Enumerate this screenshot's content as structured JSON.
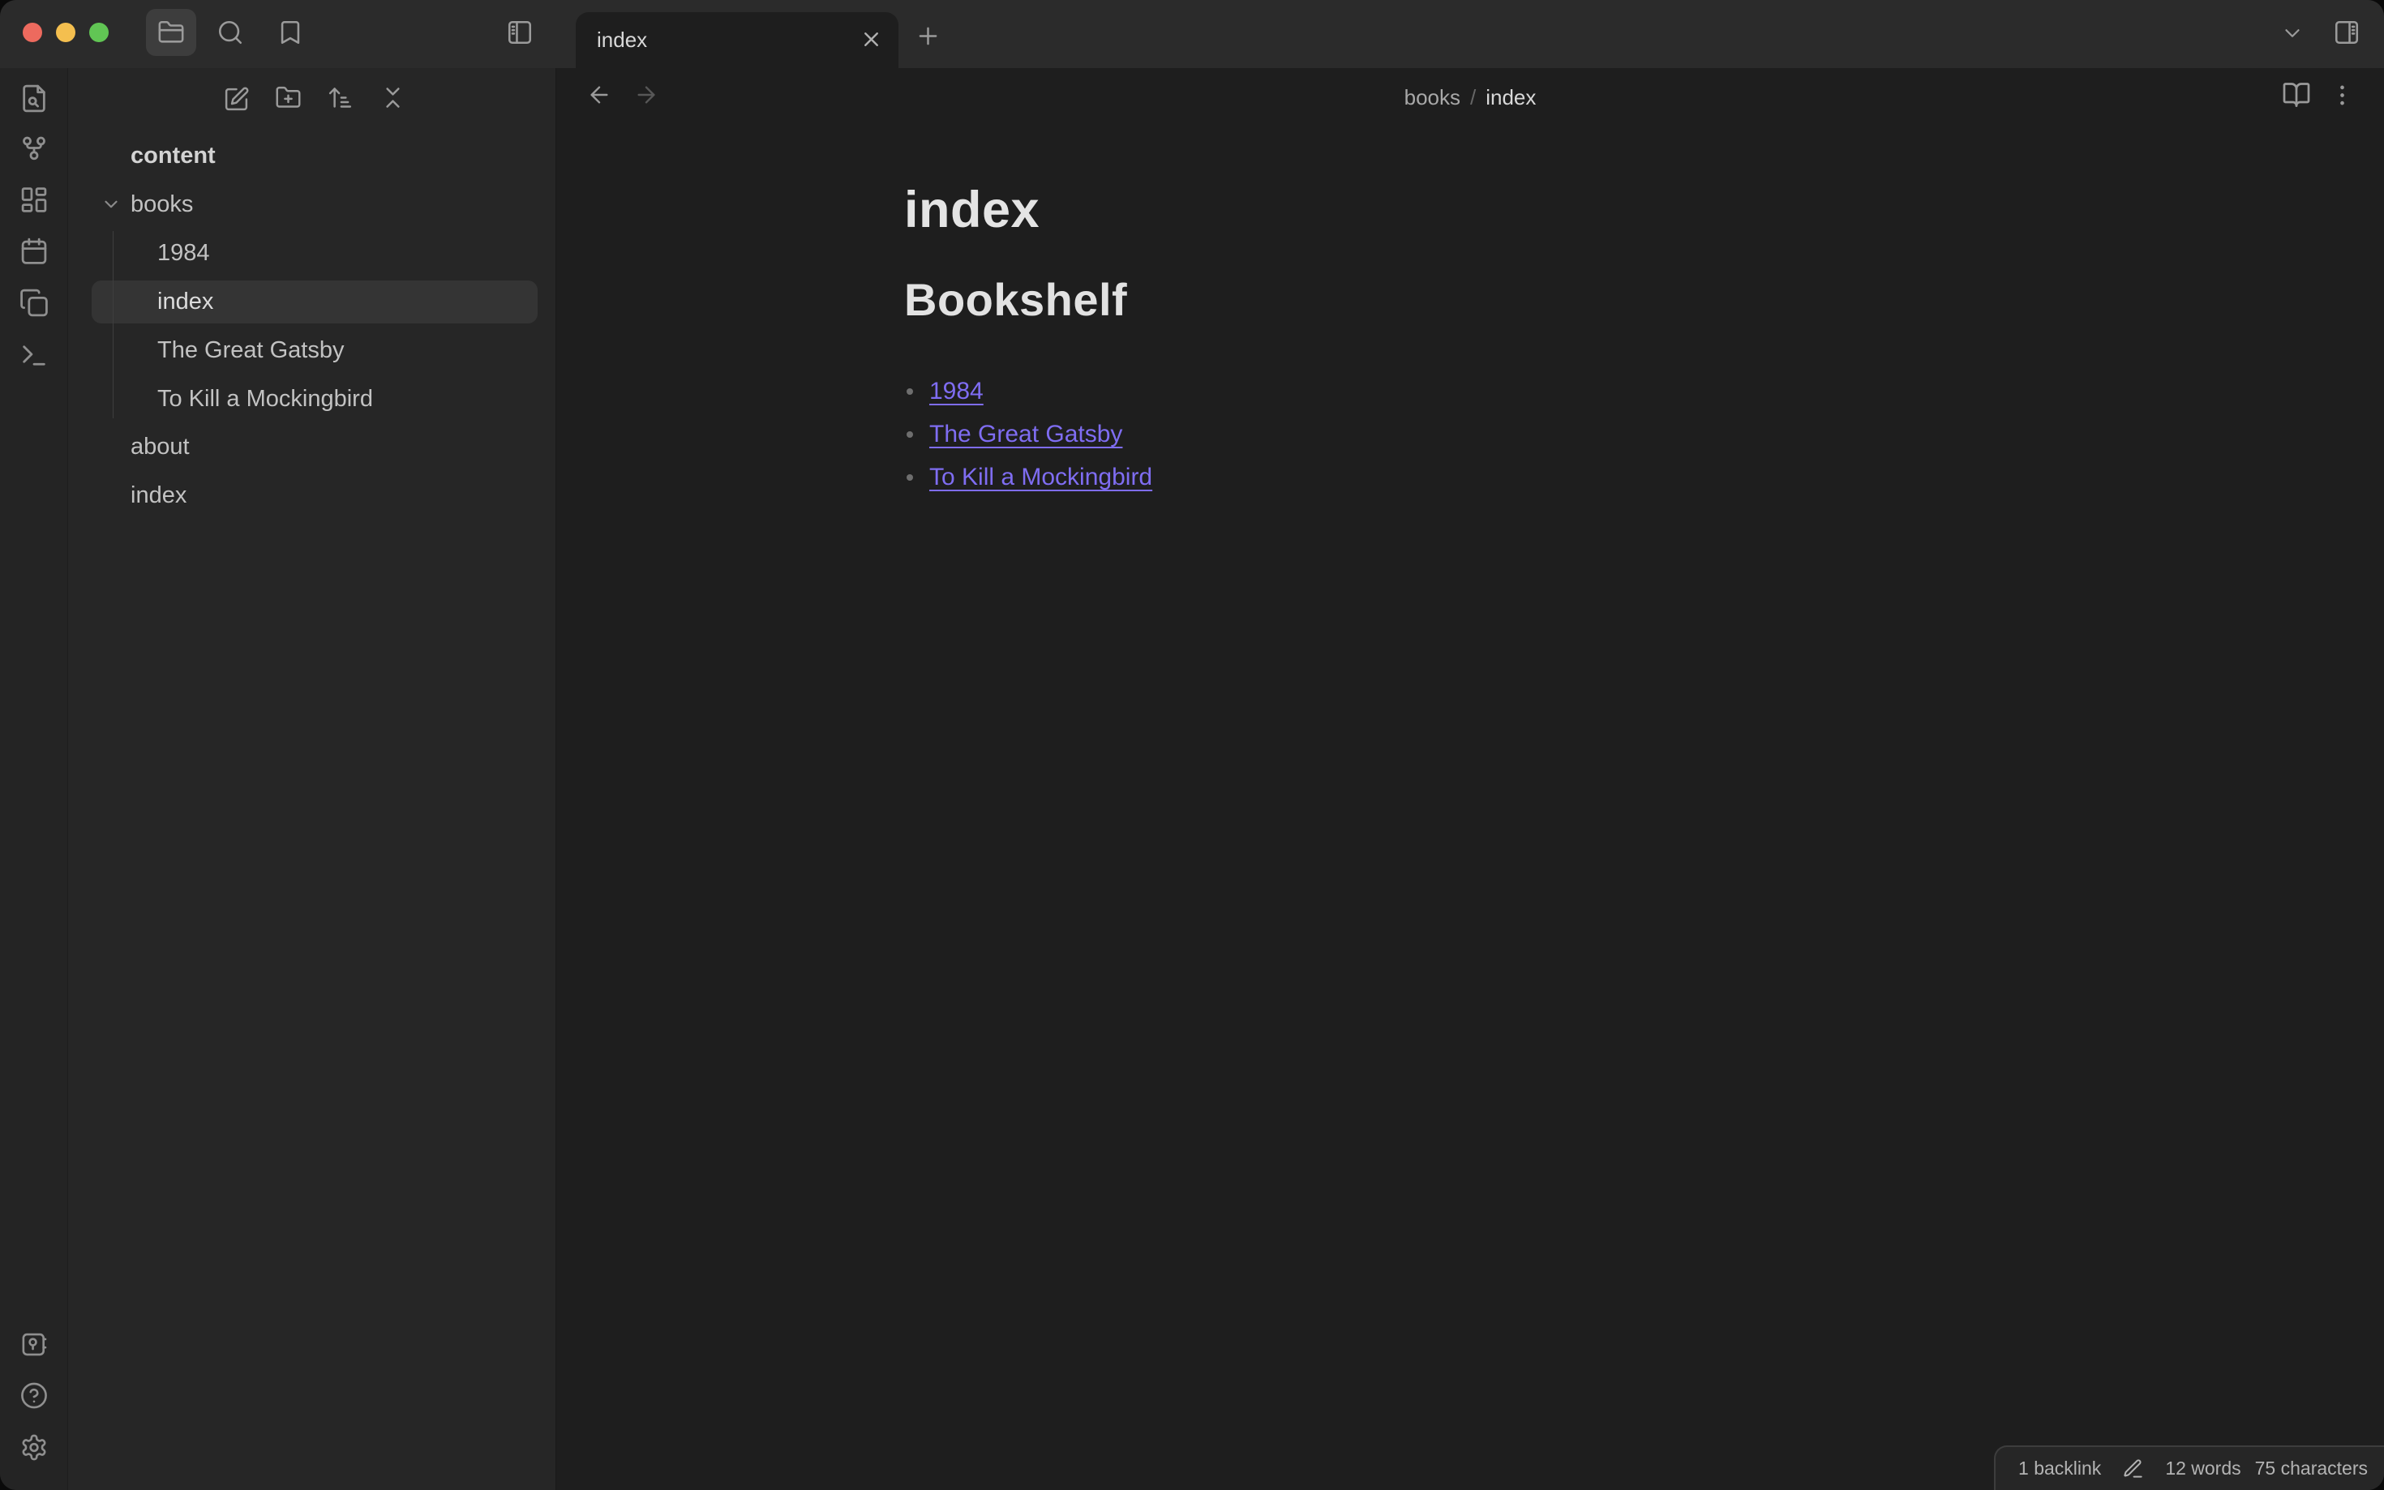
{
  "colors": {
    "accent": "#7f6df2",
    "editor_bg": "#1e1e1e",
    "sidebar_bg": "#262626",
    "titlebar_bg": "#2b2b2b",
    "ribbon_bg": "#242424"
  },
  "titlebar": {
    "tab": {
      "title": "index"
    }
  },
  "sidebar": {
    "vault_name": "content",
    "items": [
      {
        "label": "books",
        "type": "folder",
        "expanded": true
      },
      {
        "label": "1984",
        "type": "file"
      },
      {
        "label": "index",
        "type": "file",
        "selected": true
      },
      {
        "label": "The Great Gatsby",
        "type": "file"
      },
      {
        "label": "To Kill a Mockingbird",
        "type": "file"
      },
      {
        "label": "about",
        "type": "file"
      },
      {
        "label": "index",
        "type": "file"
      }
    ]
  },
  "breadcrumb": {
    "parent": "books",
    "separator": "/",
    "current": "index"
  },
  "note": {
    "inline_title": "index",
    "heading": "Bookshelf",
    "links": [
      {
        "text": "1984"
      },
      {
        "text": "The Great Gatsby"
      },
      {
        "text": "To Kill a Mockingbird"
      }
    ]
  },
  "status_bar": {
    "backlinks": "1 backlink",
    "words": "12 words",
    "characters": "75 characters"
  }
}
